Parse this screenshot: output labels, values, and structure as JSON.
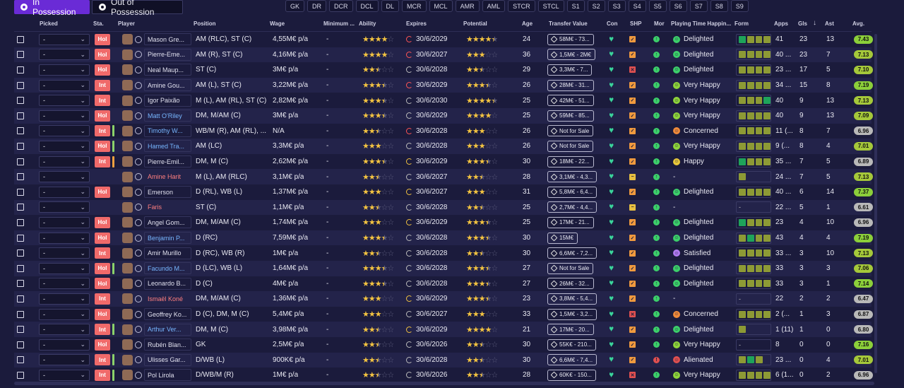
{
  "tabs": [
    {
      "label": "In Possession",
      "icon": "ball-icon",
      "active": true
    },
    {
      "label": "Out of Possession",
      "icon": "ball-icon",
      "active": false
    }
  ],
  "position_filters": [
    "GK",
    "DR",
    "DCR",
    "DCL",
    "DL",
    "MCR",
    "MCL",
    "AMR",
    "AML",
    "STCR",
    "STCL",
    "S1",
    "S2",
    "S3",
    "S4",
    "S5",
    "S6",
    "S7",
    "S8",
    "S9"
  ],
  "columns": {
    "picked": "Picked",
    "sta": "Sta.",
    "player": "Player",
    "position": "Position",
    "wage": "Wage",
    "minimum": "Minimum ...",
    "ability": "Ability",
    "expires": "Expires",
    "potential": "Potential",
    "age": "Age",
    "transfer_value": "Transfer Value",
    "con": "Con",
    "shp": "SHP",
    "mor": "Mor",
    "playing_time": "Playing Time Happin...",
    "form": "Form",
    "apps": "Apps",
    "gls": "Gls",
    "ast": "Ast",
    "avg": "Avg."
  },
  "players": [
    {
      "picked": "-",
      "sta": "Hol",
      "bar": "",
      "name": "Mason Gre...",
      "name_style": "normal",
      "position": "AM (RLC), ST (C)",
      "wage": "4,55M€ p/a",
      "min": "-",
      "ability": 4,
      "expires": "30/6/2029",
      "exp_color": "#ff5555",
      "potential": 4.5,
      "age": "24",
      "tv": "58M€ - 73...",
      "shp": "orange",
      "mor": "green",
      "happy": "Delighted",
      "happy_color": "green",
      "form": [
        "#1ea35a",
        "#8d9a35",
        "#8d9a35",
        "#8d9a35"
      ],
      "apps": "41",
      "gls": "23",
      "ast": "13",
      "avg": "7.43",
      "avg_color": "#8ccf3a"
    },
    {
      "picked": "-",
      "sta": "Hol",
      "bar": "",
      "name": "Pierre-Eme...",
      "name_style": "normal",
      "position": "AM (R), ST (C)",
      "wage": "4,16M€ p/a",
      "min": "-",
      "ability": 4,
      "expires": "30/6/2027",
      "exp_color": "#ff5555",
      "potential": 3,
      "age": "36",
      "tv": "1,5M€ - 2M€",
      "shp": "orange",
      "mor": "green",
      "happy": "Delighted",
      "happy_color": "green",
      "form": [
        "#8d9a35",
        "#8d9a35",
        "#8d9a35",
        "#8d9a35"
      ],
      "apps": "40 ...",
      "gls": "23",
      "ast": "7",
      "avg": "7.13",
      "avg_color": "#a5c83a"
    },
    {
      "picked": "-",
      "sta": "Hol",
      "bar": "",
      "name": "Neal Maup...",
      "name_style": "normal",
      "position": "ST (C)",
      "wage": "3M€ p/a",
      "min": "-",
      "ability": 2.5,
      "expires": "30/6/2028",
      "exp_color": "#bbbbbb",
      "potential": 2.5,
      "age": "29",
      "tv": "3,3M€ - 7...",
      "shp": "red",
      "mor": "green",
      "happy": "Delighted",
      "happy_color": "green",
      "form": [
        "#8d9a35",
        "#8d9a35",
        "#8d9a35",
        "#8d9a35"
      ],
      "apps": "23 ...",
      "gls": "17",
      "ast": "5",
      "avg": "7.10",
      "avg_color": "#a5c83a"
    },
    {
      "picked": "-",
      "sta": "Int",
      "bar": "",
      "name": "Amine Gou...",
      "name_style": "normal",
      "position": "AM (L), ST (C)",
      "wage": "3,22M€ p/a",
      "min": "-",
      "ability": 3.5,
      "expires": "30/6/2029",
      "exp_color": "#ff5555",
      "potential": 3.5,
      "age": "26",
      "tv": "28M€ - 31...",
      "shp": "orange",
      "mor": "green",
      "happy": "Very Happy",
      "happy_color": "lime",
      "form": [
        "#8d9a35",
        "#8d9a35",
        "#8d9a35",
        "#8d9a35"
      ],
      "apps": "34 ...",
      "gls": "15",
      "ast": "8",
      "avg": "7.19",
      "avg_color": "#8ccf3a"
    },
    {
      "picked": "-",
      "sta": "Int",
      "bar": "",
      "name": "Igor Paixão",
      "name_style": "normal",
      "position": "M (L), AM (RL), ST (C)",
      "wage": "2,82M€ p/a",
      "min": "-",
      "ability": 3.5,
      "expires": "30/6/2030",
      "exp_color": "#bbbbbb",
      "potential": 4.5,
      "age": "25",
      "tv": "42M€ - 51...",
      "shp": "orange",
      "mor": "green",
      "happy": "Very Happy",
      "happy_color": "lime",
      "form": [
        "#8d9a35",
        "#8d9a35",
        "#8d9a35",
        "#1ea35a"
      ],
      "apps": "40",
      "gls": "9",
      "ast": "13",
      "avg": "7.13",
      "avg_color": "#a5c83a"
    },
    {
      "picked": "-",
      "sta": "Hol",
      "bar": "",
      "name": "Matt O'Riley",
      "name_style": "blue",
      "position": "DM, M/AM (C)",
      "wage": "3M€ p/a",
      "min": "-",
      "ability": 3.5,
      "expires": "30/6/2029",
      "exp_color": "#bbbbbb",
      "potential": 4,
      "age": "25",
      "tv": "59M€ - 85...",
      "shp": "orange",
      "mor": "green",
      "happy": "Very Happy",
      "happy_color": "lime",
      "form": [
        "#8d9a35",
        "#8d9a35",
        "#8d9a35",
        "#8d9a35"
      ],
      "apps": "40",
      "gls": "9",
      "ast": "13",
      "avg": "7.09",
      "avg_color": "#a5c83a"
    },
    {
      "picked": "-",
      "sta": "Int",
      "bar": "#8bd36a",
      "name": "Timothy W...",
      "name_style": "blue",
      "position": "WB/M (R), AM (RL), ...",
      "wage": "N/A",
      "min": "-",
      "ability": 2.5,
      "expires": "30/6/2028",
      "exp_color": "#ff5555",
      "potential": 3,
      "age": "26",
      "tv": "Not for Sale",
      "shp": "orange",
      "mor": "green",
      "happy": "Concerned",
      "happy_color": "orange",
      "form": [
        "#8d9a35",
        "#8d9a35",
        "#8d9a35",
        "#8d9a35"
      ],
      "apps": "11 (...",
      "gls": "8",
      "ast": "7",
      "avg": "6.96",
      "avg_color": "#b9b9b9"
    },
    {
      "picked": "-",
      "sta": "Hol",
      "bar": "#8bd36a",
      "name": "Hamed Tra...",
      "name_style": "blue",
      "position": "AM (LC)",
      "wage": "3,3M€ p/a",
      "min": "-",
      "ability": 3,
      "expires": "30/6/2028",
      "exp_color": "#bbbbbb",
      "potential": 3,
      "age": "26",
      "tv": "Not for Sale",
      "shp": "orange",
      "mor": "green",
      "happy": "Very Happy",
      "happy_color": "lime",
      "form": [
        "#8d9a35",
        "#8d9a35",
        "#8d9a35",
        "#8d9a35"
      ],
      "apps": "9 (...",
      "gls": "8",
      "ast": "4",
      "avg": "7.01",
      "avg_color": "#a5c83a"
    },
    {
      "picked": "-",
      "sta": "Int",
      "bar": "#f0a040",
      "name": "Pierre-Emil...",
      "name_style": "normal",
      "position": "DM, M (C)",
      "wage": "2,62M€ p/a",
      "min": "-",
      "ability": 3.5,
      "expires": "30/6/2029",
      "exp_color": "#f0c040",
      "potential": 3.5,
      "age": "30",
      "tv": "18M€ - 22...",
      "shp": "orange",
      "mor": "green",
      "happy": "Happy",
      "happy_color": "yellow",
      "form": [
        "#1ea35a",
        "#8d9a35",
        "#8d9a35",
        "#8d9a35"
      ],
      "apps": "35 ...",
      "gls": "7",
      "ast": "5",
      "avg": "6.89",
      "avg_color": "#b9b9b9"
    },
    {
      "picked": "-",
      "sta": "",
      "bar": "",
      "name": "Amine Harit",
      "name_style": "red",
      "position": "M (L), AM (RLC)",
      "wage": "3,1M€ p/a",
      "min": "-",
      "ability": 2.5,
      "expires": "30/6/2027",
      "exp_color": "#bbbbbb",
      "potential": 2.5,
      "age": "28",
      "tv": "3,1M€ - 4,3...",
      "shp": "yellow",
      "mor": "green",
      "happy": "-",
      "happy_color": "",
      "form": [
        "#8d9a35"
      ],
      "apps": "24 ...",
      "gls": "7",
      "ast": "5",
      "avg": "7.13",
      "avg_color": "#a5c83a"
    },
    {
      "picked": "-",
      "sta": "Hol",
      "bar": "",
      "name": "Emerson",
      "name_style": "normal",
      "position": "D (RL), WB (L)",
      "wage": "1,37M€ p/a",
      "min": "-",
      "ability": 3,
      "expires": "30/6/2027",
      "exp_color": "#f0c040",
      "potential": 3,
      "age": "31",
      "tv": "5,8M€ - 6,4...",
      "shp": "orange",
      "mor": "green",
      "happy": "Delighted",
      "happy_color": "green",
      "form": [
        "#8d9a35",
        "#8d9a35",
        "#8d9a35",
        "#8d9a35"
      ],
      "apps": "40 ...",
      "gls": "6",
      "ast": "14",
      "avg": "7.37",
      "avg_color": "#8ccf3a"
    },
    {
      "picked": "-",
      "sta": "",
      "bar": "",
      "name": "Faris",
      "name_style": "red",
      "position": "ST (C)",
      "wage": "1,1M€ p/a",
      "min": "-",
      "ability": 2.5,
      "expires": "30/6/2028",
      "exp_color": "#bbbbbb",
      "potential": 2.5,
      "age": "25",
      "tv": "2,7M€ - 4,4...",
      "shp": "yellow",
      "mor": "green",
      "happy": "-",
      "happy_color": "",
      "form": [],
      "apps": "22 ...",
      "gls": "5",
      "ast": "1",
      "avg": "6.61",
      "avg_color": "#b9b9b9"
    },
    {
      "picked": "-",
      "sta": "Hol",
      "bar": "",
      "name": "Angel Gom...",
      "name_style": "normal",
      "position": "DM, M/AM (C)",
      "wage": "1,74M€ p/a",
      "min": "-",
      "ability": 3,
      "expires": "30/6/2029",
      "exp_color": "#f0c040",
      "potential": 3.5,
      "age": "25",
      "tv": "17M€ - 21...",
      "shp": "orange",
      "mor": "green",
      "happy": "Delighted",
      "happy_color": "green",
      "form": [
        "#1ea35a",
        "#8d9a35",
        "#8d9a35",
        "#8d9a35"
      ],
      "apps": "23",
      "gls": "4",
      "ast": "10",
      "avg": "6.96",
      "avg_color": "#b9b9b9"
    },
    {
      "picked": "-",
      "sta": "Hol",
      "bar": "",
      "name": "Benjamin P...",
      "name_style": "blue",
      "position": "D (RC)",
      "wage": "7,59M€ p/a",
      "min": "-",
      "ability": 3.5,
      "expires": "30/6/2028",
      "exp_color": "#bbbbbb",
      "potential": 3.5,
      "age": "30",
      "tv": "15M€",
      "shp": "orange",
      "mor": "green",
      "happy": "Delighted",
      "happy_color": "green",
      "form": [
        "#8d9a35",
        "#1ea35a",
        "#8d9a35",
        "#8d9a35"
      ],
      "apps": "43",
      "gls": "4",
      "ast": "4",
      "avg": "7.19",
      "avg_color": "#8ccf3a"
    },
    {
      "picked": "-",
      "sta": "Int",
      "bar": "",
      "name": "Amir Murillo",
      "name_style": "normal",
      "position": "D (RC), WB (R)",
      "wage": "1M€ p/a",
      "min": "-",
      "ability": 2.5,
      "expires": "30/6/2028",
      "exp_color": "#bbbbbb",
      "potential": 2.5,
      "age": "30",
      "tv": "6,6M€ - 7,2...",
      "shp": "orange",
      "mor": "green",
      "happy": "Satisfied",
      "happy_color": "purple",
      "form": [
        "#8d9a35",
        "#8d9a35",
        "#8d9a35",
        "#8d9a35"
      ],
      "apps": "33 ...",
      "gls": "3",
      "ast": "10",
      "avg": "7.13",
      "avg_color": "#a5c83a"
    },
    {
      "picked": "-",
      "sta": "Hol",
      "bar": "#8bd36a",
      "name": "Facundo M...",
      "name_style": "blue",
      "position": "D (LC), WB (L)",
      "wage": "1,64M€ p/a",
      "min": "-",
      "ability": 3.5,
      "expires": "30/6/2028",
      "exp_color": "#bbbbbb",
      "potential": 3.5,
      "age": "27",
      "tv": "Not for Sale",
      "shp": "orange",
      "mor": "green",
      "happy": "Delighted",
      "happy_color": "green",
      "form": [
        "#8d9a35",
        "#8d9a35",
        "#8d9a35",
        "#8d9a35"
      ],
      "apps": "33",
      "gls": "3",
      "ast": "3",
      "avg": "7.06",
      "avg_color": "#a5c83a"
    },
    {
      "picked": "-",
      "sta": "Hol",
      "bar": "",
      "name": "Leonardo B...",
      "name_style": "normal",
      "position": "D (C)",
      "wage": "4M€ p/a",
      "min": "-",
      "ability": 3.5,
      "expires": "30/6/2028",
      "exp_color": "#bbbbbb",
      "potential": 3.5,
      "age": "27",
      "tv": "26M€ - 32...",
      "shp": "orange",
      "mor": "green",
      "happy": "Delighted",
      "happy_color": "green",
      "form": [
        "#8d9a35",
        "#8d9a35",
        "#8d9a35",
        "#8d9a35"
      ],
      "apps": "33",
      "gls": "3",
      "ast": "1",
      "avg": "7.14",
      "avg_color": "#8ccf3a"
    },
    {
      "picked": "-",
      "sta": "Int",
      "bar": "",
      "name": "Ismaël Koné",
      "name_style": "red",
      "position": "DM, M/AM (C)",
      "wage": "1,36M€ p/a",
      "min": "-",
      "ability": 3,
      "expires": "30/6/2029",
      "exp_color": "#f0c040",
      "potential": 3.5,
      "age": "23",
      "tv": "3,8M€ - 5,4...",
      "shp": "orange",
      "mor": "green",
      "happy": "-",
      "happy_color": "",
      "form": [],
      "apps": "22",
      "gls": "2",
      "ast": "2",
      "avg": "6.47",
      "avg_color": "#b9b9b9"
    },
    {
      "picked": "-",
      "sta": "Hol",
      "bar": "",
      "name": "Geoffrey Ko...",
      "name_style": "normal",
      "position": "D (C), DM, M (C)",
      "wage": "5,4M€ p/a",
      "min": "-",
      "ability": 3,
      "expires": "30/6/2027",
      "exp_color": "#bbbbbb",
      "potential": 3,
      "age": "33",
      "tv": "1,5M€ - 3,2...",
      "shp": "red",
      "mor": "green",
      "happy": "Concerned",
      "happy_color": "orange",
      "form": [
        "#8d9a35",
        "#8d9a35",
        "#8d9a35",
        "#8d9a35"
      ],
      "apps": "2 (...",
      "gls": "1",
      "ast": "3",
      "avg": "6.87",
      "avg_color": "#b9b9b9"
    },
    {
      "picked": "-",
      "sta": "Int",
      "bar": "#8bd36a",
      "name": "Arthur Ver...",
      "name_style": "blue",
      "position": "DM, M (C)",
      "wage": "3,98M€ p/a",
      "min": "-",
      "ability": 2.5,
      "expires": "30/6/2029",
      "exp_color": "#f0c040",
      "potential": 4,
      "age": "21",
      "tv": "17M€ - 20...",
      "shp": "orange",
      "mor": "green",
      "happy": "Delighted",
      "happy_color": "green",
      "form": [
        "#8d9a35"
      ],
      "apps": "1 (11)",
      "gls": "1",
      "ast": "0",
      "avg": "6.80",
      "avg_color": "#b9b9b9"
    },
    {
      "picked": "-",
      "sta": "Hol",
      "bar": "",
      "name": "Rubén Blan...",
      "name_style": "normal",
      "position": "GK",
      "wage": "2,5M€ p/a",
      "min": "-",
      "ability": 2.5,
      "expires": "30/6/2026",
      "exp_color": "#bbbbbb",
      "potential": 2.5,
      "age": "30",
      "tv": "55K€ - 210...",
      "shp": "orange",
      "mor": "green",
      "happy": "Very Happy",
      "happy_color": "lime",
      "form": [],
      "apps": "8",
      "gls": "0",
      "ast": "0",
      "avg": "7.16",
      "avg_color": "#8ccf3a"
    },
    {
      "picked": "-",
      "sta": "Int",
      "bar": "#8bd36a",
      "name": "Ulisses Gar...",
      "name_style": "normal",
      "position": "D/WB (L)",
      "wage": "900K€ p/a",
      "min": "-",
      "ability": 2.5,
      "expires": "30/6/2028",
      "exp_color": "#bbbbbb",
      "potential": 2.5,
      "age": "30",
      "tv": "6,6M€ - 7,4...",
      "shp": "orange",
      "mor": "red",
      "happy": "Alienated",
      "happy_color": "red",
      "form": [
        "#8d9a35",
        "#1ea35a",
        "#8d9a35"
      ],
      "apps": "23 ...",
      "gls": "0",
      "ast": "4",
      "avg": "7.01",
      "avg_color": "#a5c83a"
    },
    {
      "picked": "-",
      "sta": "Int",
      "bar": "#8bd36a",
      "name": "Pol Lirola",
      "name_style": "normal",
      "position": "D/WB/M (R)",
      "wage": "1M€ p/a",
      "min": "-",
      "ability": 2.5,
      "expires": "30/6/2026",
      "exp_color": "#bbbbbb",
      "potential": 2.5,
      "age": "28",
      "tv": "60K€ - 150...",
      "shp": "red",
      "mor": "green",
      "happy": "Very Happy",
      "happy_color": "lime",
      "form": [
        "#8d9a35",
        "#8d9a35",
        "#8d9a35",
        "#8d9a35"
      ],
      "apps": "6 (1...",
      "gls": "0",
      "ast": "2",
      "avg": "6.96",
      "avg_color": "#b9b9b9"
    }
  ],
  "colors": {
    "accent": "#6a2bd6",
    "background": "#1b1b3c",
    "status_hol": "#f06a6a"
  }
}
